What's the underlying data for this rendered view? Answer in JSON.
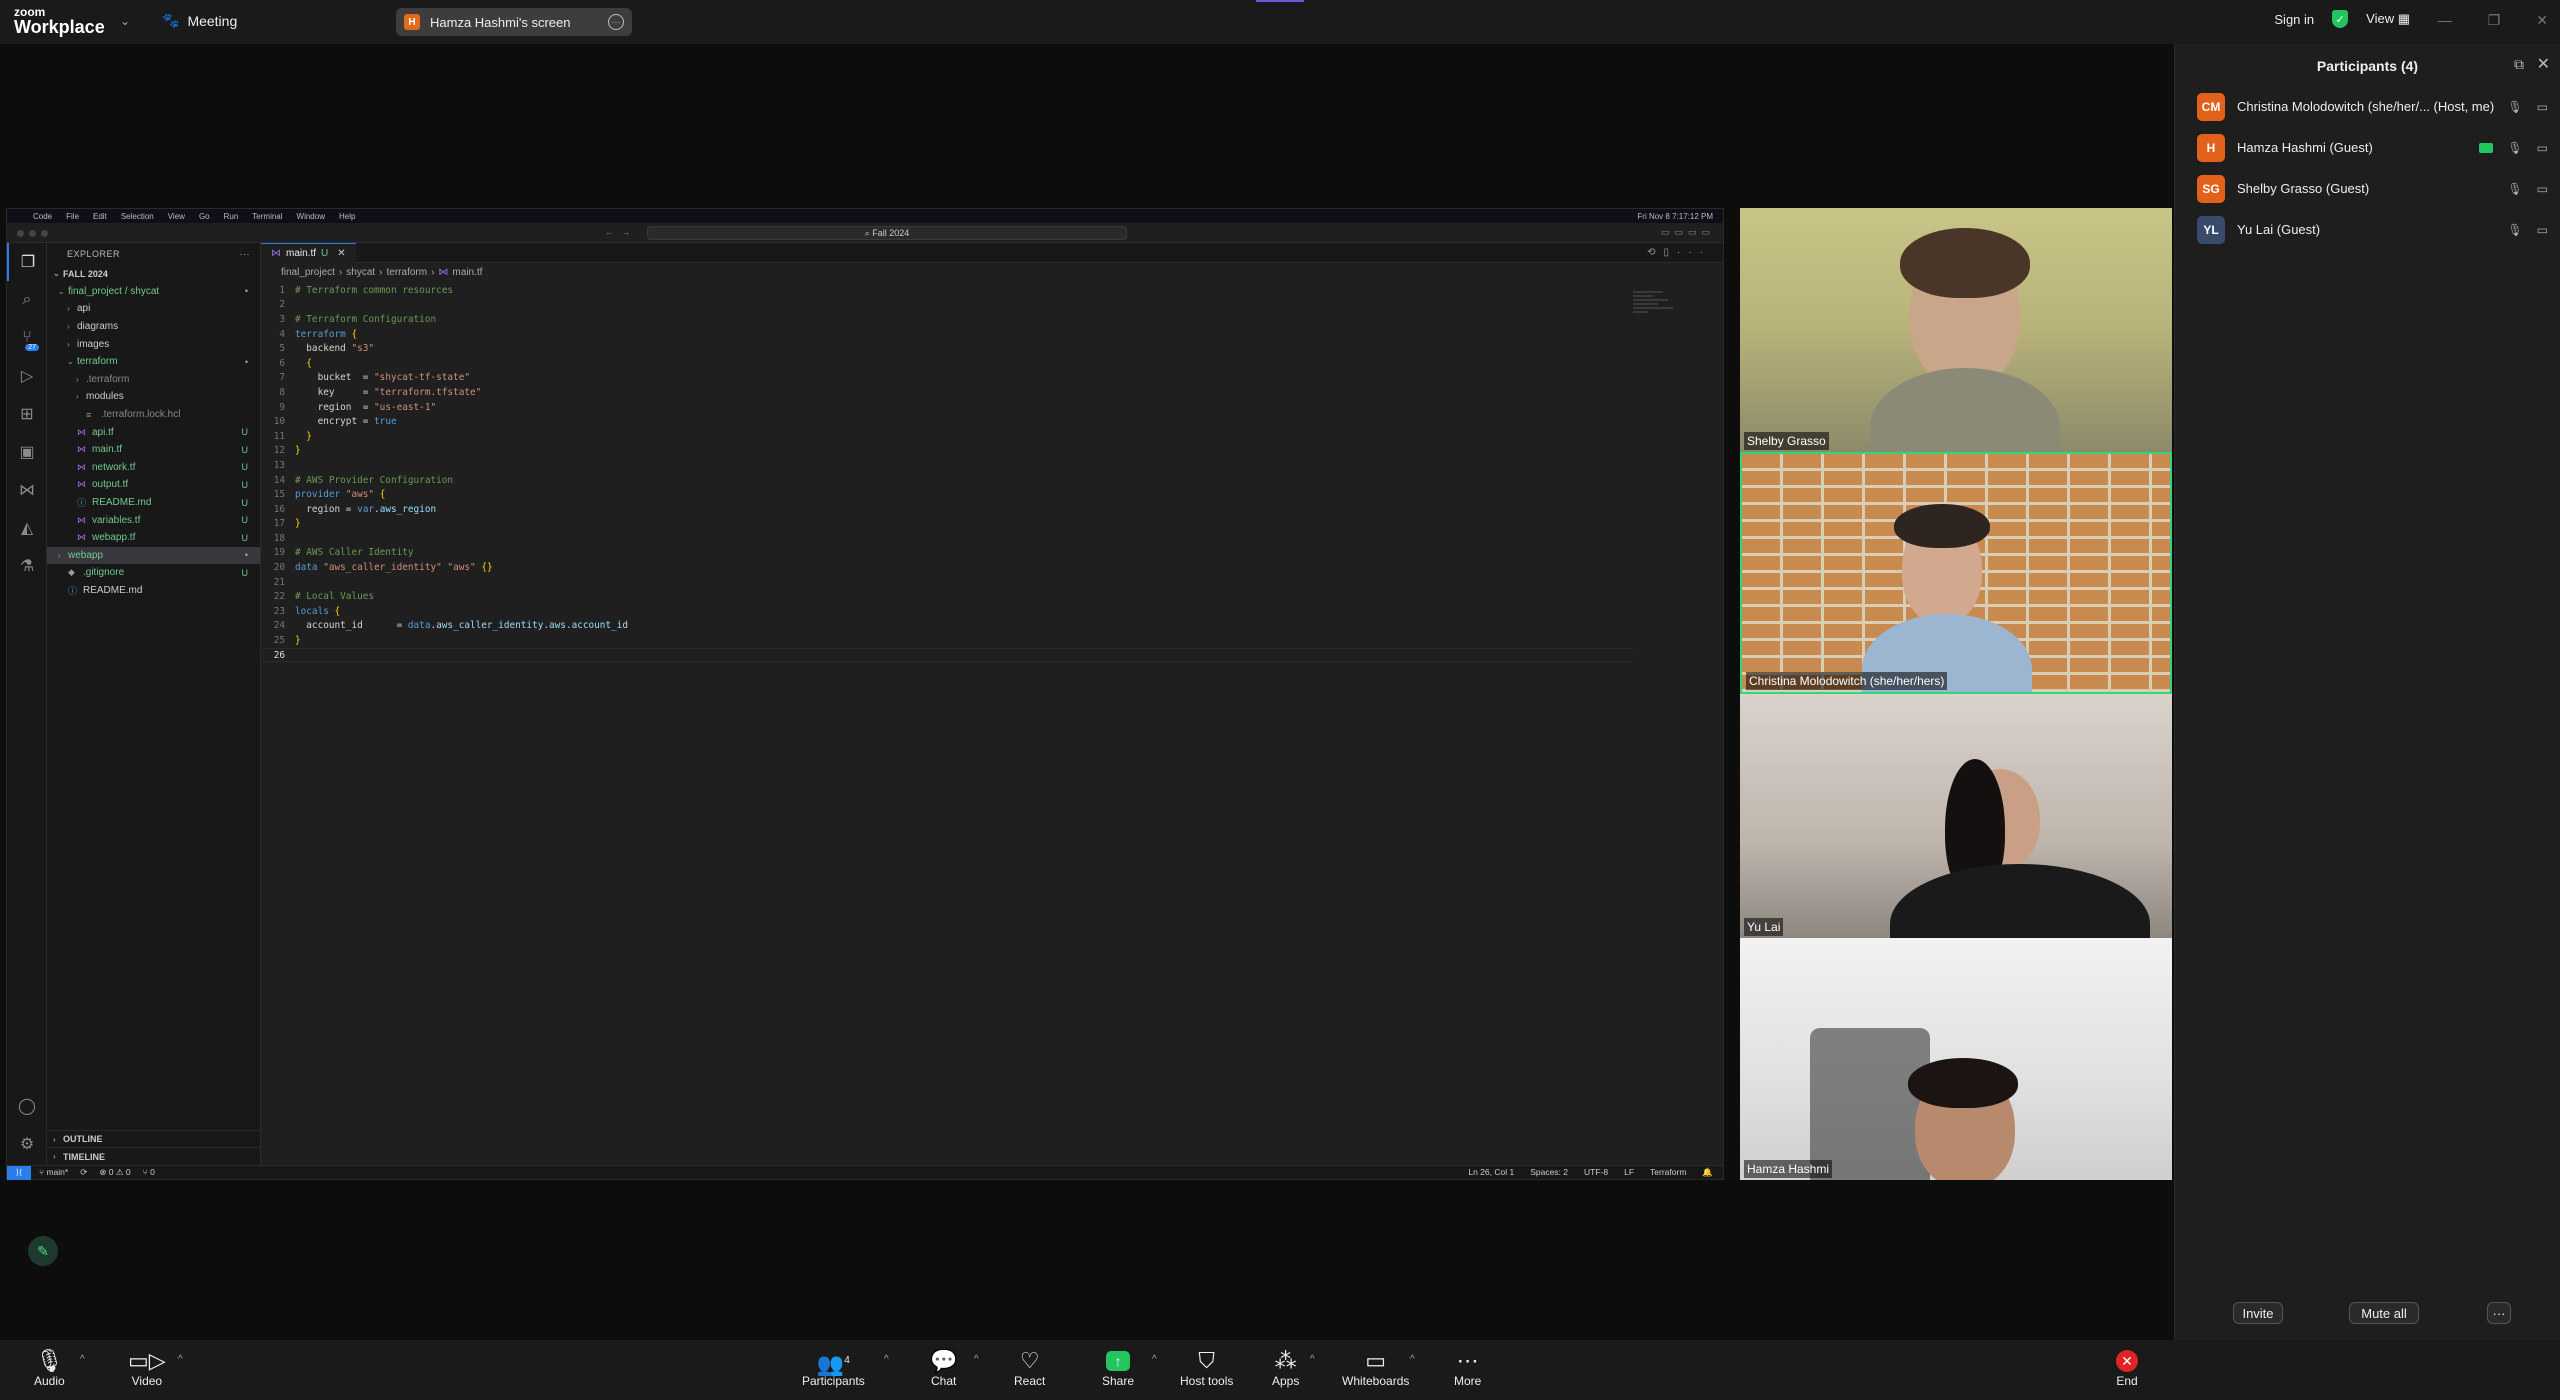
{
  "app": {
    "brand_top": "zoom",
    "brand_name": "Workplace",
    "meeting_label": "Meeting",
    "share_pill_initial": "H",
    "share_pill_label": "Hamza Hashmi's screen",
    "sign_in": "Sign in",
    "view": "View"
  },
  "vscode": {
    "mac_menu": [
      "Code",
      "File",
      "Edit",
      "Selection",
      "View",
      "Go",
      "Run",
      "Terminal",
      "Window",
      "Help"
    ],
    "mac_clock": "Fri Nov 8  7:17:12 PM",
    "command_center": "Fall 2024",
    "explorer_title": "EXPLORER",
    "workspace": "FALL 2024",
    "tree": [
      {
        "label": "final_project / shycat",
        "indent": 1,
        "chev": "⌄",
        "stat": "•",
        "cls": "green-t"
      },
      {
        "label": "api",
        "indent": 2,
        "chev": "›",
        "stat": "",
        "cls": ""
      },
      {
        "label": "diagrams",
        "indent": 2,
        "chev": "›",
        "stat": "",
        "cls": ""
      },
      {
        "label": "images",
        "indent": 2,
        "chev": "›",
        "stat": "",
        "cls": ""
      },
      {
        "label": "terraform",
        "indent": 2,
        "chev": "⌄",
        "stat": "•",
        "cls": "green-t"
      },
      {
        "label": ".terraform",
        "indent": 3,
        "chev": "›",
        "stat": "",
        "cls": "dim"
      },
      {
        "label": "modules",
        "indent": 3,
        "chev": "›",
        "stat": "",
        "cls": ""
      },
      {
        "label": ".terraform.lock.hcl",
        "indent": 3,
        "chev": "",
        "stat": "",
        "cls": "dim",
        "icon": "≡"
      },
      {
        "label": "api.tf",
        "indent": 2,
        "chev": "",
        "stat": "U",
        "cls": "green-t",
        "icon": "tf"
      },
      {
        "label": "main.tf",
        "indent": 2,
        "chev": "",
        "stat": "U",
        "cls": "green-t",
        "icon": "tf"
      },
      {
        "label": "network.tf",
        "indent": 2,
        "chev": "",
        "stat": "U",
        "cls": "green-t",
        "icon": "tf"
      },
      {
        "label": "output.tf",
        "indent": 2,
        "chev": "",
        "stat": "U",
        "cls": "green-t",
        "icon": "tf"
      },
      {
        "label": "README.md",
        "indent": 2,
        "chev": "",
        "stat": "U",
        "cls": "green-t",
        "icon": "md"
      },
      {
        "label": "variables.tf",
        "indent": 2,
        "chev": "",
        "stat": "U",
        "cls": "green-t",
        "icon": "tf"
      },
      {
        "label": "webapp.tf",
        "indent": 2,
        "chev": "",
        "stat": "U",
        "cls": "green-t",
        "icon": "tf"
      },
      {
        "label": "webapp",
        "indent": 1,
        "chev": "›",
        "stat": "•",
        "cls": "green-t",
        "sel": true
      },
      {
        "label": ".gitignore",
        "indent": 1,
        "chev": "",
        "stat": "U",
        "cls": "green-t",
        "icon": "◆"
      },
      {
        "label": "README.md",
        "indent": 1,
        "chev": "",
        "stat": "",
        "cls": "",
        "icon": "md"
      }
    ],
    "outline": "OUTLINE",
    "timeline": "TIMELINE",
    "tab_name": "main.tf",
    "tab_status": "U",
    "breadcrumb": [
      "final_project",
      "shycat",
      "terraform",
      "main.tf"
    ],
    "code_lines": [
      "# Terraform common resources",
      "",
      "# Terraform Configuration",
      "terraform {",
      "  backend \"s3\"",
      "  {",
      "    bucket  = \"shycat-tf-state\"",
      "    key     = \"terraform.tfstate\"",
      "    region  = \"us-east-1\"",
      "    encrypt = true",
      "  }",
      "}",
      "",
      "# AWS Provider Configuration",
      "provider \"aws\" {",
      "  region = var.aws_region",
      "}",
      "",
      "# AWS Caller Identity",
      "data \"aws_caller_identity\" \"aws\" {}",
      "",
      "# Local Values",
      "locals {",
      "  account_id      = data.aws_caller_identity.aws.account_id",
      "}",
      ""
    ],
    "status_left": [
      "main*",
      "⟳",
      "⊗ 0 ⚠ 0",
      "⑂ 0"
    ],
    "status_right": [
      "Ln 26, Col 1",
      "Spaces: 2",
      "UTF-8",
      "LF",
      "Terraform",
      "🔔"
    ],
    "scm_badge": "27"
  },
  "videos": [
    {
      "name": "Shelby Grasso"
    },
    {
      "name": "Christina Molodowitch (she/her/hers)"
    },
    {
      "name": "Yu Lai"
    },
    {
      "name": "Hamza Hashmi"
    }
  ],
  "participants": {
    "title": "Participants (4)",
    "list": [
      {
        "initials": "CM",
        "color": "#e2621b",
        "name": "Christina Molodowitch (she/her/...  (Host, me)"
      },
      {
        "initials": "H",
        "color": "#e2621b",
        "name": "Hamza Hashmi (Guest)"
      },
      {
        "initials": "SG",
        "color": "#e2621b",
        "name": "Shelby Grasso (Guest)"
      },
      {
        "initials": "YL",
        "color": "#3a4a6b",
        "name": "Yu Lai (Guest)"
      }
    ],
    "invite": "Invite",
    "mute_all": "Mute all",
    "more": "···"
  },
  "toolbar": {
    "audio": "Audio",
    "video": "Video",
    "participants": "Participants",
    "participants_count": "4",
    "chat": "Chat",
    "react": "React",
    "share": "Share",
    "host_tools": "Host tools",
    "apps": "Apps",
    "whiteboards": "Whiteboards",
    "more": "More",
    "end": "End"
  }
}
